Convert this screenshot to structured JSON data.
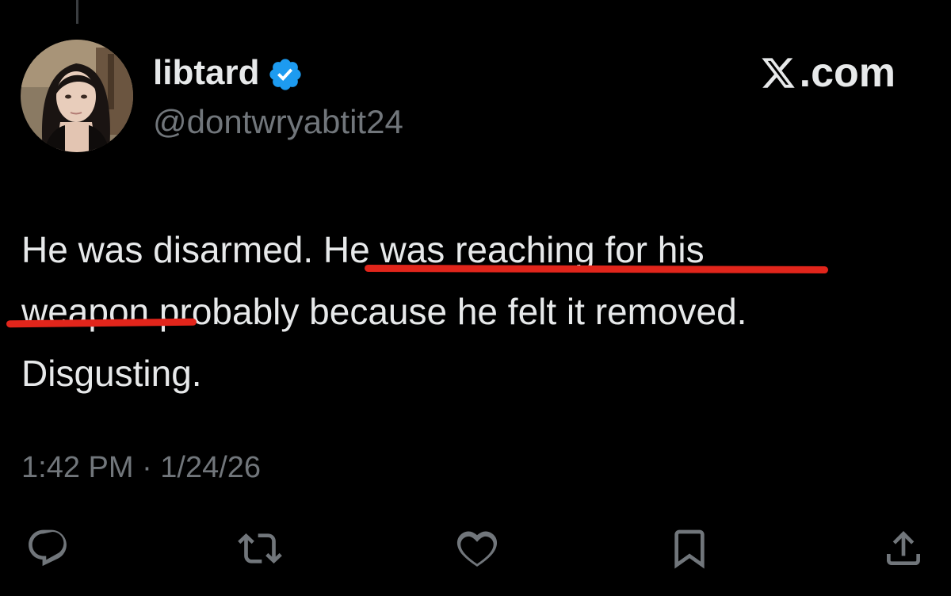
{
  "author": {
    "display_name": "libtard",
    "handle": "@dontwryabtit24",
    "verified_icon": "verified-badge-icon",
    "avatar": "avatar"
  },
  "brand": {
    "label": ".com",
    "icon": "x-logo-icon"
  },
  "tweet": {
    "lines": [
      "He was disarmed. He was reaching for his",
      "weapon probably because he felt it removed.",
      "Disgusting."
    ]
  },
  "timestamp": "1:42 PM · 1/24/26",
  "actions": [
    {
      "name": "reply",
      "icon": "reply-icon"
    },
    {
      "name": "repost",
      "icon": "repost-icon"
    },
    {
      "name": "like",
      "icon": "heart-icon"
    },
    {
      "name": "bookmark",
      "icon": "bookmark-icon"
    },
    {
      "name": "share",
      "icon": "share-icon"
    }
  ],
  "colors": {
    "background": "#000000",
    "text": "#e7e9ea",
    "secondary_text": "#71767b",
    "verified": "#1d9bf0",
    "underline": "#e1251b"
  }
}
